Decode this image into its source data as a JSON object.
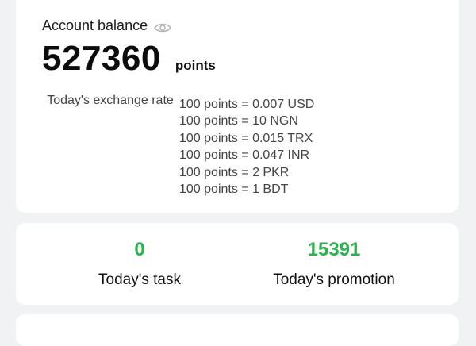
{
  "balance": {
    "label": "Account balance",
    "visibility_icon": "eye-icon",
    "amount": "527360",
    "unit": "points",
    "rate_label": "Today's exchange rate",
    "rates": [
      "100 points = 0.007 USD",
      "100 points = 10 NGN",
      "100 points = 0.015 TRX",
      "100 points = 0.047 INR",
      "100 points = 2 PKR",
      "100 points = 1 BDT"
    ]
  },
  "stats": {
    "task": {
      "value": "0",
      "label": "Today's task"
    },
    "promotion": {
      "value": "15391",
      "label": "Today's promotion"
    }
  },
  "colors": {
    "accent_green": "#28b44c",
    "background": "#f1f2f4",
    "card": "#ffffff"
  }
}
